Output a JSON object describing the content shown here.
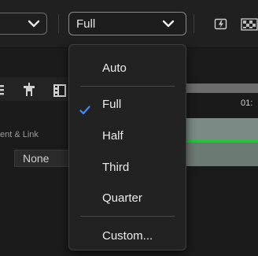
{
  "toolbar": {
    "resolution_value": "Full"
  },
  "panel": {
    "column_label": "ent & Link",
    "none_value": "None",
    "ruler_number": "01:"
  },
  "menu": {
    "items": [
      {
        "label": "Auto",
        "checked": false
      },
      {
        "label": "Full",
        "checked": true
      },
      {
        "label": "Half",
        "checked": false
      },
      {
        "label": "Third",
        "checked": false
      },
      {
        "label": "Quarter",
        "checked": false
      },
      {
        "label": "Custom...",
        "checked": false
      }
    ]
  },
  "colors": {
    "check_accent": "#3f8cff",
    "track_green": "#24c43a"
  },
  "icons": [
    "chevron-down-icon",
    "checkmark-icon",
    "fast-preview-icon",
    "transparency-grid-icon",
    "puzzle-icon",
    "film-icon",
    "grip-icon"
  ]
}
